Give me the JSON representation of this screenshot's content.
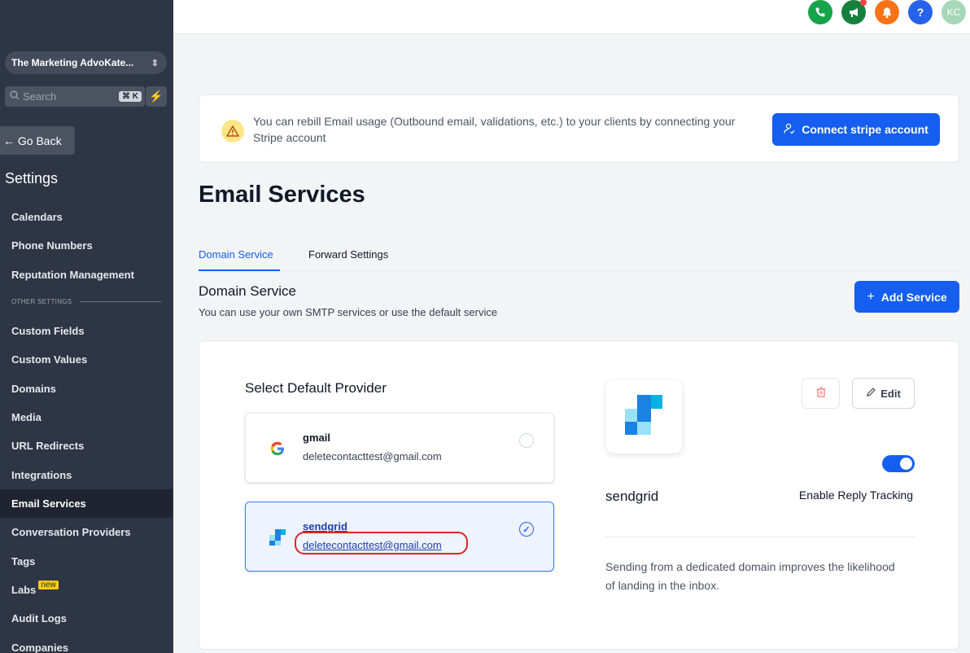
{
  "sidebar": {
    "account_name": "The Marketing AdvoKate...",
    "search_label": "Search",
    "search_shortcut": "⌘ K",
    "go_back": "← Go Back",
    "settings_title": "Settings",
    "items": [
      {
        "label": "Calendars"
      },
      {
        "label": "Phone Numbers"
      },
      {
        "label": "Reputation Management"
      }
    ],
    "section_label": "OTHER SETTINGS",
    "items2": [
      {
        "label": "Custom Fields"
      },
      {
        "label": "Custom Values"
      },
      {
        "label": "Domains"
      },
      {
        "label": "Media"
      },
      {
        "label": "URL Redirects"
      },
      {
        "label": "Integrations"
      },
      {
        "label": "Email Services"
      },
      {
        "label": "Conversation Providers"
      },
      {
        "label": "Tags"
      },
      {
        "label": "Labs"
      },
      {
        "label": "Audit Logs"
      },
      {
        "label": "Companies"
      }
    ],
    "labs_badge": "new",
    "active_item": "Email Services"
  },
  "topbar": {
    "avatar_initials": "KC",
    "help_label": "?"
  },
  "banner": {
    "text": "You can rebill Email usage (Outbound email, validations, etc.) to your clients by connecting your Stripe account",
    "button": "Connect stripe account"
  },
  "page": {
    "title": "Email Services",
    "tabs": [
      {
        "label": "Domain Service",
        "active": true
      },
      {
        "label": "Forward Settings",
        "active": false
      }
    ],
    "section_title": "Domain Service",
    "section_subtitle": "You can use your own SMTP services or use the default service",
    "add_button": "Add Service",
    "add_button_icon": "+"
  },
  "providers": {
    "title": "Select Default Provider",
    "items": [
      {
        "name": "gmail",
        "email": "deletecontacttest@gmail.com",
        "selected": false
      },
      {
        "name": "sendgrid",
        "email": "deletecontacttest@gmail.com",
        "selected": true
      }
    ]
  },
  "detail": {
    "name": "sendgrid",
    "edit_label": "Edit",
    "reply_tracking_label": "Enable Reply Tracking",
    "reply_tracking_enabled": true,
    "description": "Sending from a dedicated domain improves the likelihood of landing in the inbox."
  },
  "colors": {
    "primary": "#155eef",
    "sidebar_bg": "#2e3544",
    "phone": "#16a34a",
    "megaphone": "#15803d",
    "bell": "#f97316",
    "help": "#2563eb",
    "avatar": "#a7d7b8"
  }
}
